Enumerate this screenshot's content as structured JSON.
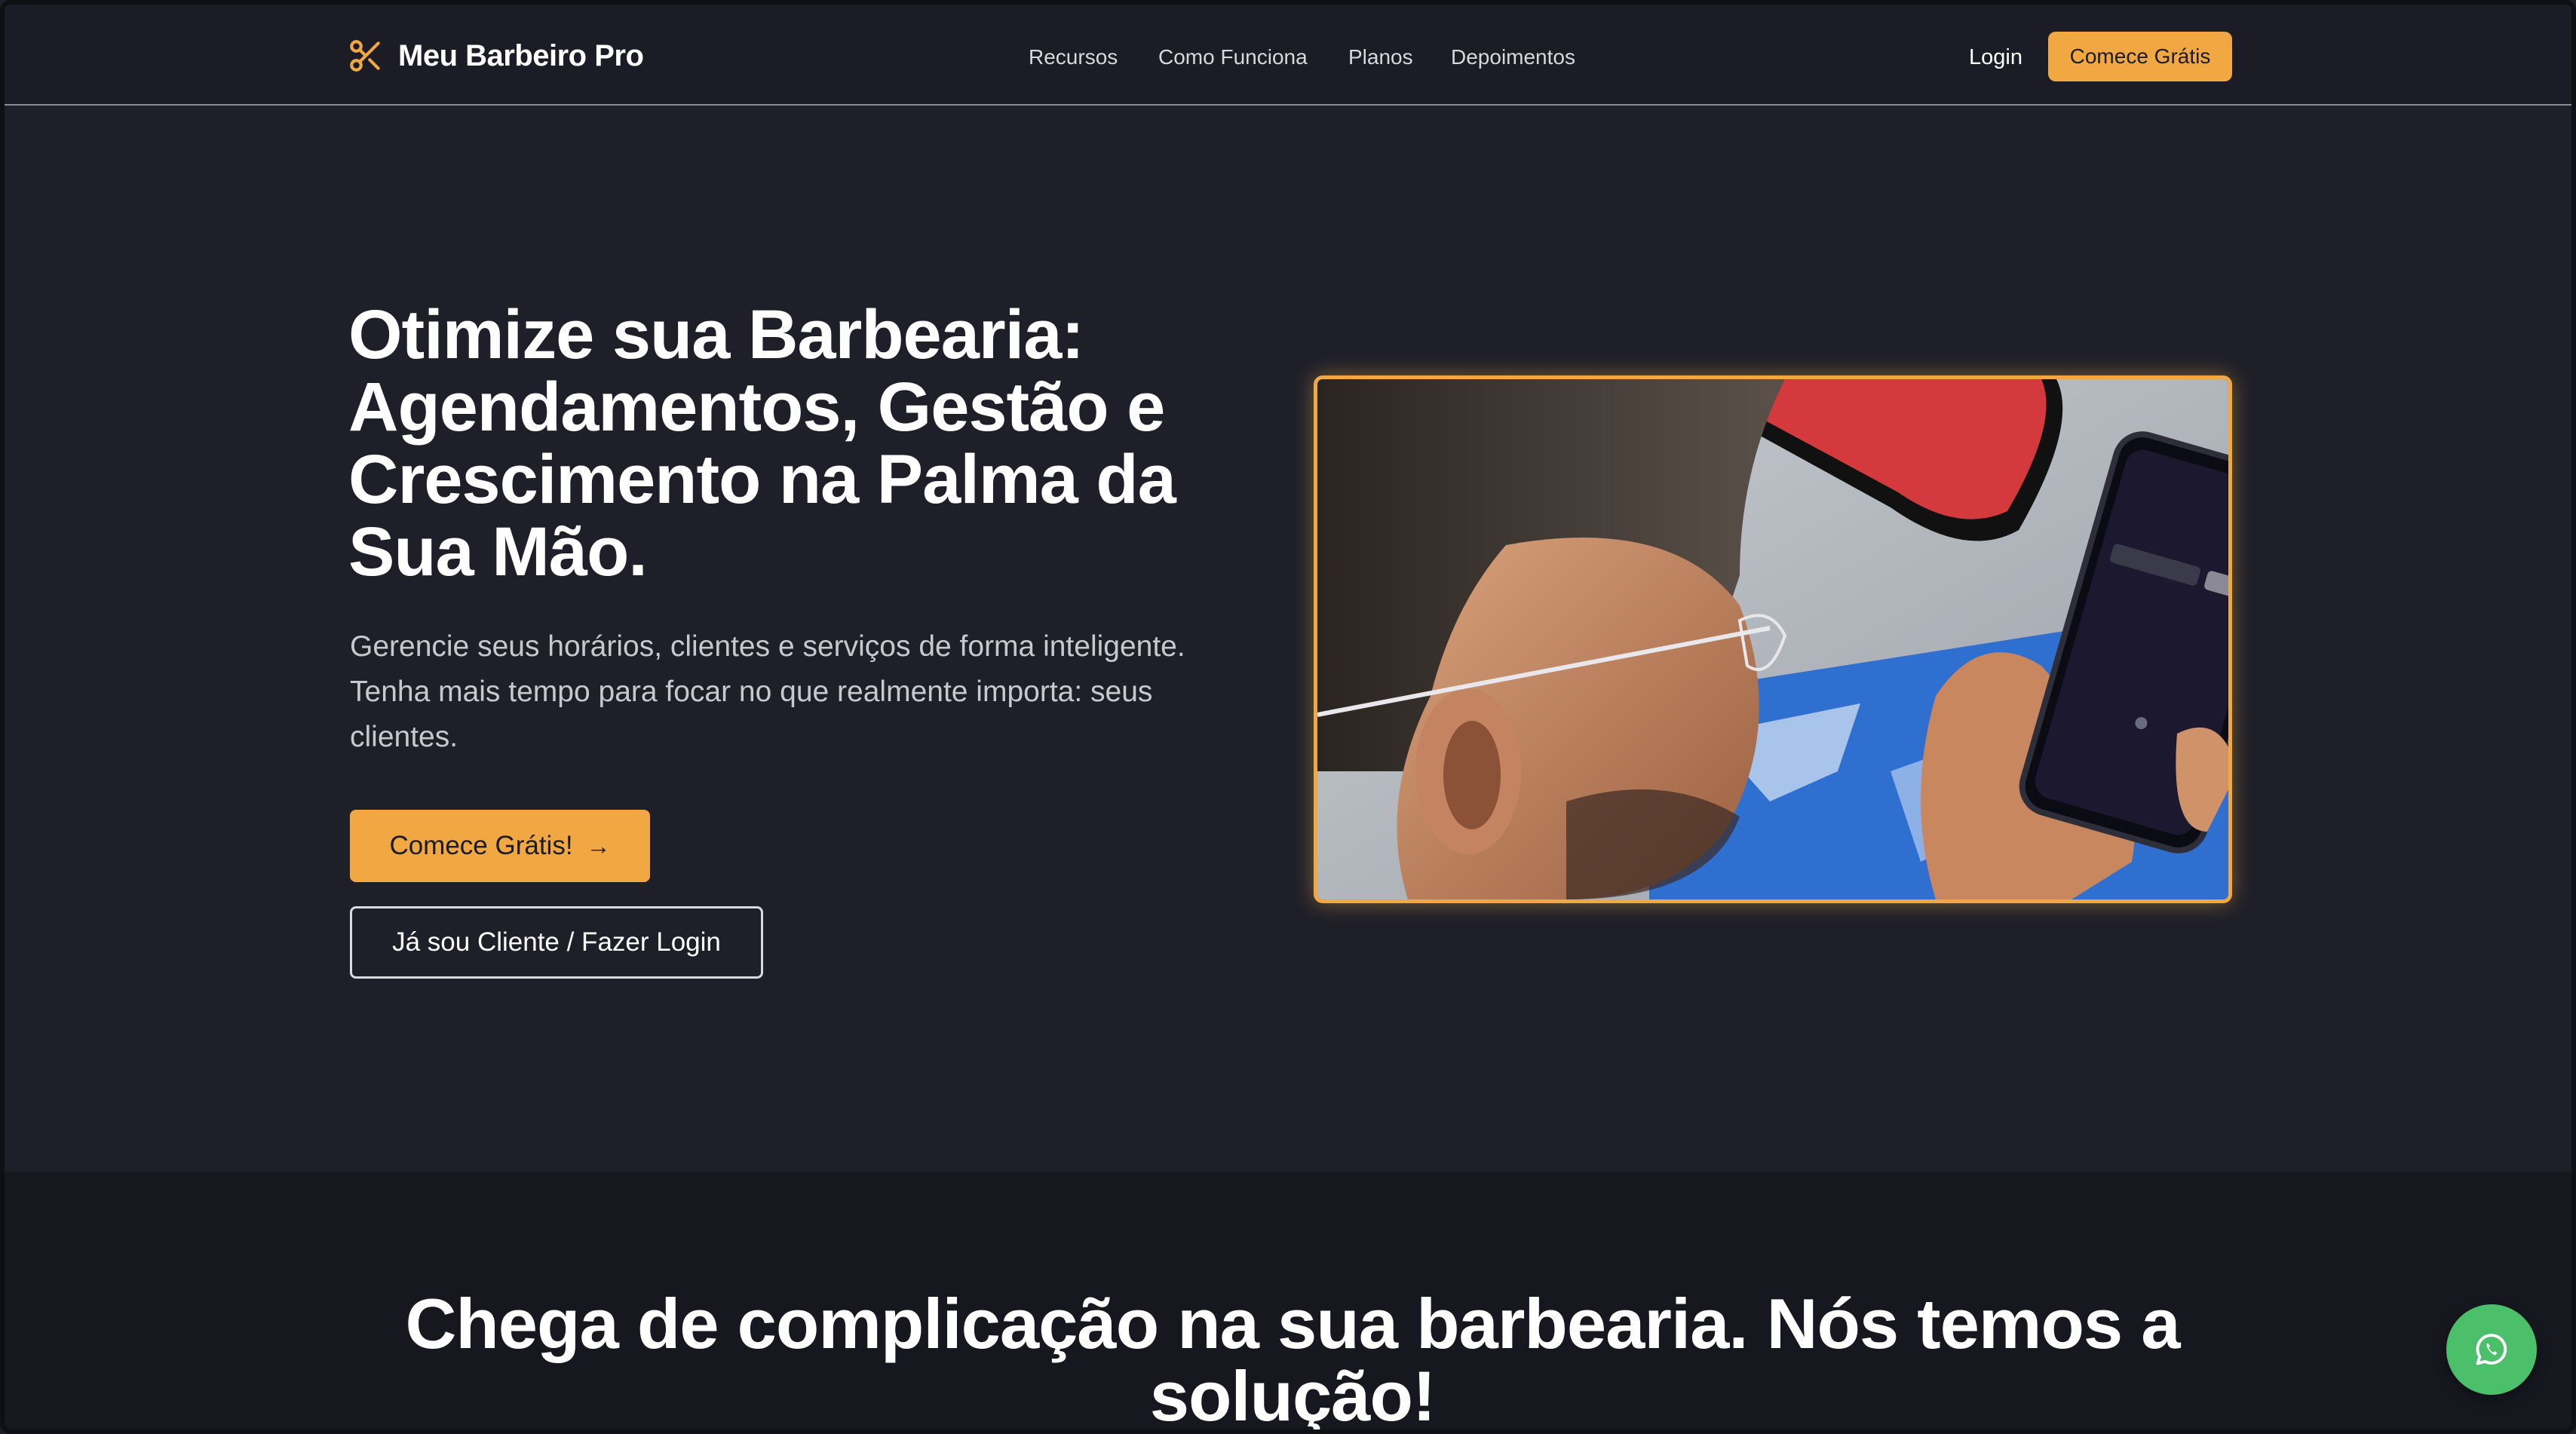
{
  "colors": {
    "accent": "#f1a843",
    "background": "#1e1f29",
    "navbar": "#1b1c25",
    "whatsapp": "#4cbf6a"
  },
  "brand": {
    "name": "Meu Barbeiro Pro",
    "icon": "scissors-icon"
  },
  "nav": {
    "links": [
      "Recursos",
      "Como Funciona",
      "Planos",
      "Depoimentos"
    ],
    "login_label": "Login",
    "cta_label": "Comece Grátis"
  },
  "hero": {
    "title": "Otimize sua Barbearia: Agendamentos, Gestão e Crescimento na Palma da Sua Mão.",
    "subtitle": "Gerencie seus horários, clientes e serviços de forma inteligente. Tenha mais tempo para focar no que realmente importa: seus clientes.",
    "primary_button": "Comece Grátis!",
    "primary_button_icon": "arrow-right-icon",
    "secondary_button": "Já sou Cliente / Fazer Login"
  },
  "section2": {
    "title": "Chega de complicação na sua barbearia. Nós temos a solução!"
  },
  "floating": {
    "icon": "whatsapp-icon"
  }
}
